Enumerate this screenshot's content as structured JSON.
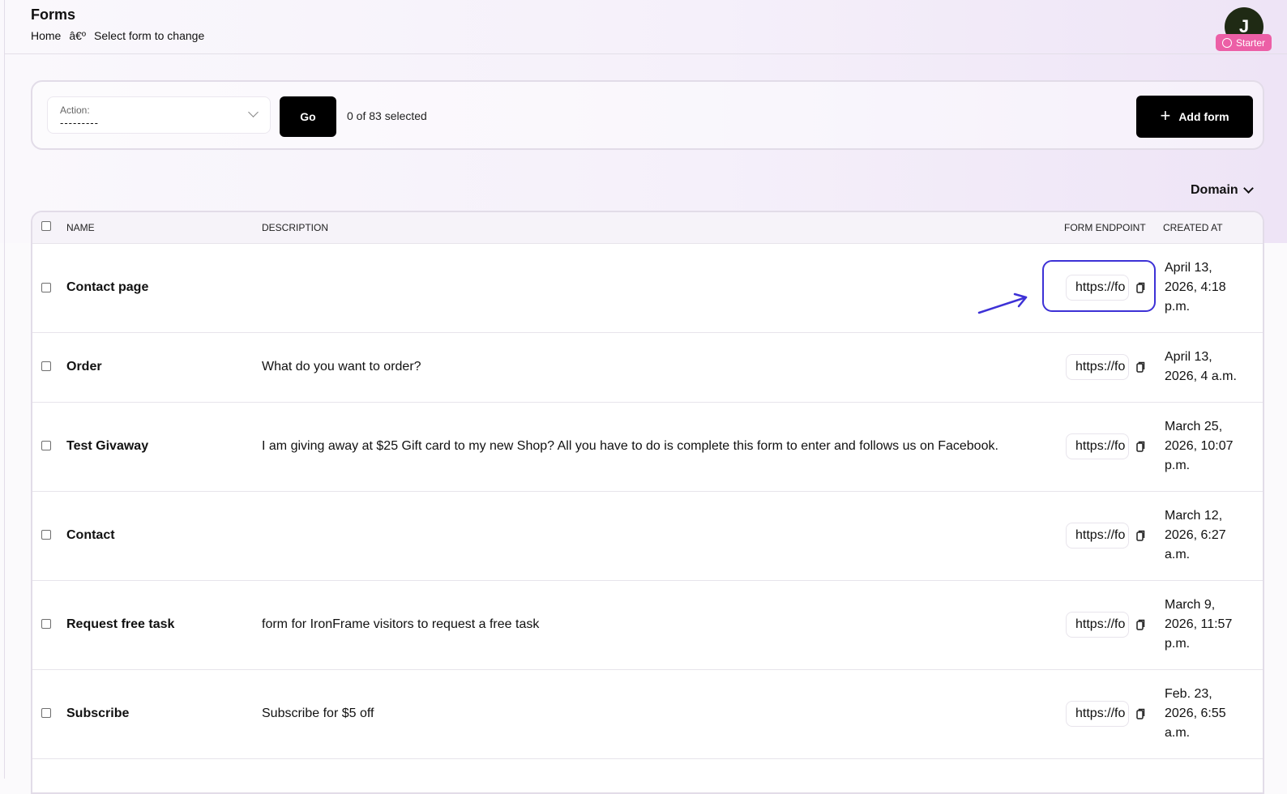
{
  "header": {
    "title": "Forms",
    "breadcrumb": {
      "home": "Home",
      "separator": "â€º",
      "current": "Select form to change"
    },
    "avatar_initial": "J",
    "plan_badge": "Starter"
  },
  "actions": {
    "action_label": "Action:",
    "action_value": "---------",
    "go_label": "Go",
    "selected_count": "0 of 83 selected",
    "add_label": "Add form"
  },
  "filter": {
    "domain_label": "Domain"
  },
  "table": {
    "columns": {
      "name": "Name",
      "description": "Description",
      "endpoint": "Form endpoint",
      "created": "Created at"
    },
    "rows": [
      {
        "name": "Contact page",
        "description": "",
        "endpoint": "https://fo",
        "created": "April 13, 2026, 4:18 p.m."
      },
      {
        "name": "Order",
        "description": "What do you want to order?",
        "endpoint": "https://fo",
        "created": "April 13, 2026, 4 a.m."
      },
      {
        "name": "Test Givaway",
        "description": "I am giving away at $25 Gift card to my new Shop? All you have to do is complete this form to enter and follows us on Facebook.",
        "endpoint": "https://fo",
        "created": "March 25, 2026, 10:07 p.m."
      },
      {
        "name": "Contact",
        "description": "",
        "endpoint": "https://fo",
        "created": "March 12, 2026, 6:27 a.m."
      },
      {
        "name": "Request free task",
        "description": "form for IronFrame visitors to request a free task",
        "endpoint": "https://fo",
        "created": "March 9, 2026, 11:57 p.m."
      },
      {
        "name": "Subscribe",
        "description": "Subscribe for $5 off",
        "endpoint": "https://fo",
        "created": "Feb. 23, 2026, 6:55 a.m."
      }
    ]
  },
  "colors": {
    "annotation": "#3d31d6",
    "badge": "#ec5fa6",
    "avatar": "#1f2a14",
    "primary_button": "#000000"
  },
  "icons": {
    "copy": "copy-icon",
    "plus": "plus-icon",
    "chevron": "chevron-down-icon"
  }
}
